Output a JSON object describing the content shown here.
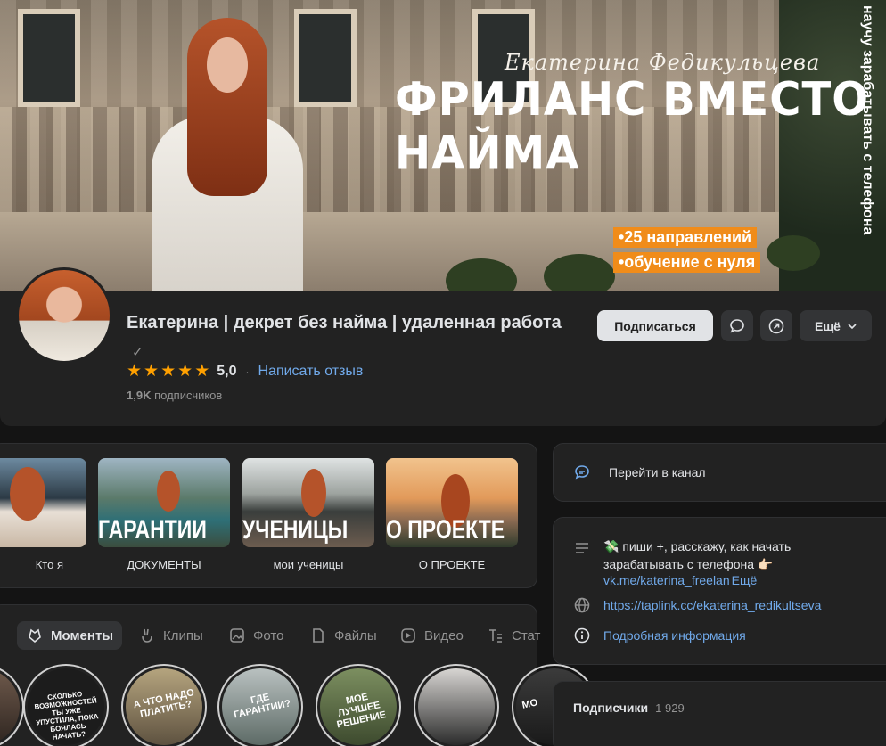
{
  "cover": {
    "author": "Екатерина Федикульцева",
    "title": "ФРИЛАНС ВМЕСТО НАЙМА",
    "tags": [
      "•25 направлений",
      "•обучение с нуля"
    ],
    "side_text": "научу зарабатывать с телефона"
  },
  "profile": {
    "name": "Екатерина | декрет без найма | удаленная работа",
    "verified_icon": "check-icon",
    "rating_value": "5,0",
    "stars": 5,
    "review_link": "Написать отзыв",
    "subscribers_count": "1,9K",
    "subscribers_label": "подписчиков"
  },
  "actions": {
    "subscribe": "Подписаться",
    "more": "Ещё"
  },
  "albums": [
    {
      "caption": "",
      "label": "Кто я"
    },
    {
      "caption": "ГАРАНТИИ",
      "label": "ДОКУМЕНТЫ"
    },
    {
      "caption": "УЧЕНИЦЫ",
      "label": "мои ученицы"
    },
    {
      "caption": "О ПРОЕКТЕ",
      "label": "О ПРОЕКТЕ"
    }
  ],
  "tabs": [
    {
      "label": "Моменты",
      "icon": "moments-icon",
      "active": true
    },
    {
      "label": "Клипы",
      "icon": "clips-icon",
      "active": false
    },
    {
      "label": "Фото",
      "icon": "photo-icon",
      "active": false
    },
    {
      "label": "Файлы",
      "icon": "files-icon",
      "active": false
    },
    {
      "label": "Видео",
      "icon": "video-icon",
      "active": false
    },
    {
      "label": "Стат",
      "icon": "text-icon",
      "active": false
    }
  ],
  "moments": [
    {
      "text": ""
    },
    {
      "text": "СКОЛЬКО ВОЗМОЖНОСТЕЙ ТЫ УЖЕ УПУСТИЛА, ПОКА БОЯЛАСЬ НАЧАТЬ?"
    },
    {
      "text": "А ЧТО НАДО ПЛАТИТЬ?"
    },
    {
      "text": "ГДЕ ГАРАНТИИ?"
    },
    {
      "text": "МОЕ ЛУЧШЕЕ РЕШЕНИЕ"
    },
    {
      "text": ""
    },
    {
      "text": "МО"
    }
  ],
  "sidebar": {
    "channel_button": "Перейти в канал",
    "status_text": "💸 пиши +, расскажу, как начать зарабатывать с телефона 👉🏻",
    "status_link": "vk.me/katerina_freelan",
    "status_more": "Ещё",
    "site_link": "https://taplink.cc/ekaterina_redikultseva",
    "info_link": "Подробная информация",
    "subscribers_title": "Подписчики",
    "subscribers_count": "1 929"
  },
  "colors": {
    "background": "#141414",
    "card": "#222222",
    "accent": "#71aaeb",
    "star": "#ffa000",
    "tag": "#f08c1a"
  }
}
